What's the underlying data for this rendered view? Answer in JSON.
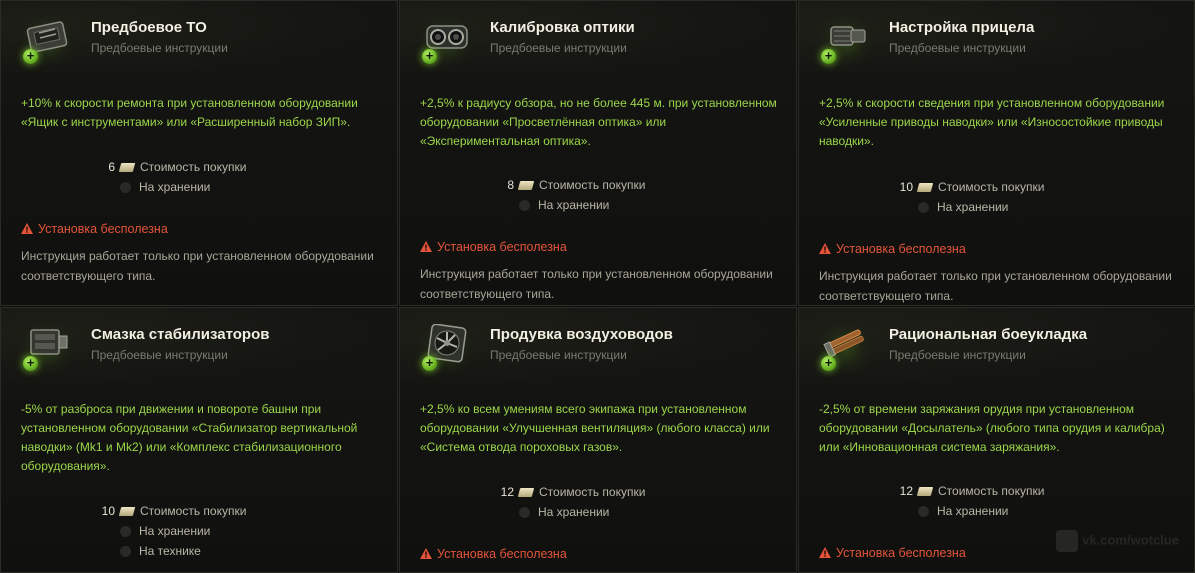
{
  "cards": [
    {
      "title": "Предбоевое ТО",
      "subtitle": "Предбоевые инструкции",
      "icon": "toolbox-icon",
      "desc": "+10% к скорости ремонта при установленном оборудовании «Ящик с инструментами» или «Расширенный набор ЗИП».",
      "price": "6",
      "price_label": "Стоимость покупки",
      "storage_label": "На хранении",
      "warning": "Установка бесполезна",
      "note": "Инструкция работает только при установленном оборудовании соответствующего типа."
    },
    {
      "title": "Калибровка оптики",
      "subtitle": "Предбоевые инструкции",
      "icon": "optics-icon",
      "desc": "+2,5% к радиусу обзора, но не более 445 м. при установленном оборудовании «Просветлённая оптика» или «Экспериментальная оптика».",
      "price": "8",
      "price_label": "Стоимость покупки",
      "storage_label": "На хранении",
      "warning": "Установка бесполезна",
      "note": "Инструкция работает только при установленном оборудовании соответствующего типа."
    },
    {
      "title": "Настройка прицела",
      "subtitle": "Предбоевые инструкции",
      "icon": "gun-drive-icon",
      "desc": "+2,5% к скорости сведения при установленном оборудовании «Усиленные приводы наводки» или «Износостойкие приводы наводки».",
      "price": "10",
      "price_label": "Стоимость покупки",
      "storage_label": "На хранении",
      "warning": "Установка бесполезна",
      "note": "Инструкция работает только при установленном оборудовании соответствующего типа."
    },
    {
      "title": "Смазка стабилизаторов",
      "subtitle": "Предбоевые инструкции",
      "icon": "stabilizer-icon",
      "desc": "-5% от разброса при движении и повороте башни при установленном оборудовании «Стабилизатор вертикальной наводки» (Mk1 и Mk2) или «Комплекс стабилизационного оборудования».",
      "price": "10",
      "price_label": "Стоимость покупки",
      "storage_label": "На хранении",
      "vehicle_label": "На технике"
    },
    {
      "title": "Продувка воздуховодов",
      "subtitle": "Предбоевые инструкции",
      "icon": "fan-icon",
      "desc": "+2,5% ко всем умениям всего экипажа при установленном оборудовании «Улучшенная вентиляция» (любого класса) или «Система отвода пороховых газов».",
      "price": "12",
      "price_label": "Стоимость покупки",
      "storage_label": "На хранении",
      "warning": "Установка бесполезна"
    },
    {
      "title": "Рациональная боеукладка",
      "subtitle": "Предбоевые инструкции",
      "icon": "rammer-icon",
      "desc": "-2,5% от времени заряжания орудия при установленном оборудовании «Досылатель» (любого типа орудия и калибра) или «Инновационная система заряжания».",
      "price": "12",
      "price_label": "Стоимость покупки",
      "storage_label": "На хранении",
      "warning": "Установка бесполезна"
    }
  ],
  "watermark": "vk.com/wotclue",
  "colors": {
    "accent_green": "#9bd64a",
    "warning_red": "#e3543a",
    "title": "#f2efe3"
  }
}
